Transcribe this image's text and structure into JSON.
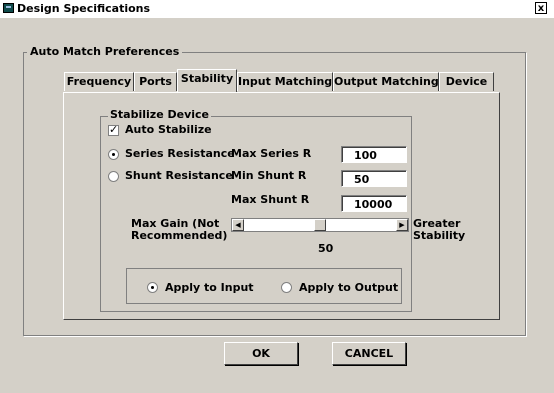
{
  "window": {
    "title": "Design Specifications",
    "close_label": "x"
  },
  "preferences": {
    "legend": "Auto Match Preferences"
  },
  "tabs": [
    {
      "label": "Frequency"
    },
    {
      "label": "Ports"
    },
    {
      "label": "Stability",
      "active": true
    },
    {
      "label": "Input Matching"
    },
    {
      "label": "Output Matching"
    },
    {
      "label": "Device"
    }
  ],
  "stabilize": {
    "legend": "Stabilize Device",
    "auto_stabilize_label": "Auto Stabilize",
    "auto_stabilize_checked": true,
    "series_label": "Series Resistance",
    "shunt_label": "Shunt Resistance",
    "selected_mode": "Series Resistance",
    "max_series_label": "Max Series R",
    "max_series_value": "100",
    "min_shunt_label": "Min Shunt R",
    "min_shunt_value": "50",
    "max_shunt_label": "Max Shunt R",
    "max_shunt_value": "10000"
  },
  "gain": {
    "left_label_1": "Max Gain (Not",
    "left_label_2": "Recommended)",
    "right_label_1": "Greater",
    "right_label_2": "Stability",
    "value": "50",
    "level_fraction": 0.5
  },
  "apply": {
    "input_label": "Apply to Input",
    "output_label": "Apply to Output",
    "selected": "Apply to Input"
  },
  "buttons": {
    "ok": "OK",
    "cancel": "CANCEL"
  },
  "icons": {
    "app": "app-window-icon",
    "close": "close-icon",
    "check": "checkmark-icon",
    "left": "arrow-left-icon",
    "right": "arrow-right-icon"
  }
}
